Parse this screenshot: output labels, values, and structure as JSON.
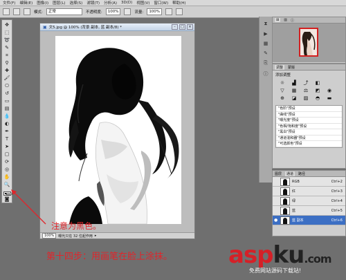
{
  "menubar": {
    "items": [
      "文件(F)",
      "编辑(E)",
      "图像(I)",
      "图层(L)",
      "选择(S)",
      "滤镜(T)",
      "分析(A)",
      "3D(D)",
      "视图(V)",
      "窗口(W)",
      "帮助(H)"
    ]
  },
  "options_bar": {
    "mode_label": "模式:",
    "mode_value": "正常",
    "opacity_label": "不透明度:",
    "opacity_value": "100%",
    "flow_label": "流量:",
    "flow_value": "100%"
  },
  "document": {
    "title": "文5.jpg @ 100% (背景 副本, 蓝 副本/8) *",
    "zoom": "100%",
    "status": "曝光只在 32 位起作用"
  },
  "annotations": {
    "note": "注意为黑色。",
    "step": "第十四步：用画笔在脸上涂抹。"
  },
  "adjustments": {
    "header": "添加调整",
    "presets": [
      "\"色阶\"预设",
      "\"曲线\"预设",
      "\"曝光度\"预设",
      "\"色相/饱和度\"预设",
      "\"黑白\"预设",
      "\"通道混和器\"预设",
      "\"可选颜色\"预设"
    ]
  },
  "channels": {
    "tabs": [
      "图层",
      "通道",
      "路径"
    ],
    "rows": [
      {
        "name": "RGB",
        "key": "Ctrl+2",
        "selected": false
      },
      {
        "name": "红",
        "key": "Ctrl+3",
        "selected": false
      },
      {
        "name": "绿",
        "key": "Ctrl+4",
        "selected": false
      },
      {
        "name": "蓝",
        "key": "Ctrl+5",
        "selected": false
      },
      {
        "name": "蓝 副本",
        "key": "Ctrl+6",
        "selected": true
      }
    ]
  },
  "watermark": {
    "brand_red": "asp",
    "brand_black": "ku",
    "brand_tld": ".com",
    "tagline": "免费网站源码下载站!"
  },
  "colors": {
    "foreground": "#000000",
    "background": "#ffffff",
    "annotation": "#e0252b",
    "selection": "#3c6fc4"
  }
}
